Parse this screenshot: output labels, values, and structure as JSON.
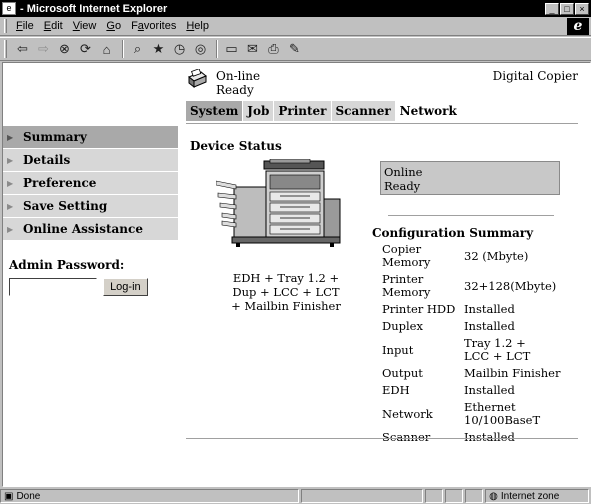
{
  "window": {
    "title": " - Microsoft Internet Explorer"
  },
  "menus": [
    {
      "pre": "",
      "u": "F",
      "post": "ile"
    },
    {
      "pre": "",
      "u": "E",
      "post": "dit"
    },
    {
      "pre": "",
      "u": "V",
      "post": "iew"
    },
    {
      "pre": "",
      "u": "G",
      "post": "o"
    },
    {
      "pre": "F",
      "u": "a",
      "post": "vorites"
    },
    {
      "pre": "",
      "u": "H",
      "post": "elp"
    }
  ],
  "header": {
    "status_line1": "On-line",
    "status_line2": "Ready",
    "model": "Digital Copier"
  },
  "tabs": [
    "System",
    "Job",
    "Printer",
    "Scanner",
    "Network"
  ],
  "nav": [
    "Summary",
    "Details",
    "Preference",
    "Save Setting",
    "Online Assistance"
  ],
  "admin": {
    "label": "Admin Password:",
    "button": "Log-in"
  },
  "device": {
    "title": "Device Status",
    "caption_lines": [
      "EDH + Tray 1.2 +",
      "Dup + LCC + LCT",
      "+ Mailbin Finisher"
    ],
    "status_line1": "Online",
    "status_line2": "Ready"
  },
  "config": {
    "title": "Configuration Summary",
    "rows": [
      {
        "k": "Copier Memory",
        "v": "32 (Mbyte)"
      },
      {
        "k": "Printer Memory",
        "v": "32+128(Mbyte)"
      },
      {
        "k": "Printer HDD",
        "v": "Installed"
      },
      {
        "k": "Duplex",
        "v": "Installed"
      },
      {
        "k": "Input",
        "v": "Tray 1.2 +\nLCC + LCT"
      },
      {
        "k": "Output",
        "v": "Mailbin Finisher"
      },
      {
        "k": "EDH",
        "v": "Installed"
      },
      {
        "k": "Network",
        "v": "Ethernet\n10/100BaseT"
      },
      {
        "k": "Scanner",
        "v": "Installed"
      }
    ]
  },
  "statusbar": {
    "left": "Done",
    "zone": "Internet zone"
  },
  "toolbar_icons": [
    "back-icon",
    "forward-icon",
    "stop-icon",
    "refresh-icon",
    "home-icon",
    "search-icon",
    "favorites-icon",
    "history-icon",
    "channels-icon",
    "fullscreen-icon",
    "mail-icon",
    "print-icon",
    "edit-icon"
  ]
}
